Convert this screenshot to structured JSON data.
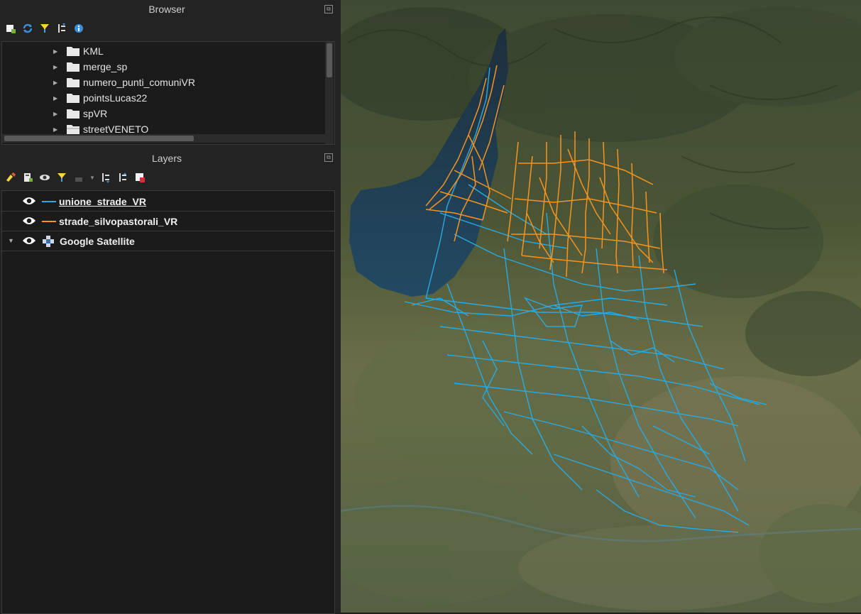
{
  "browser": {
    "title": "Browser",
    "items": [
      {
        "label": "KML"
      },
      {
        "label": "merge_sp"
      },
      {
        "label": "numero_punti_comuniVR"
      },
      {
        "label": "pointsLucas22"
      },
      {
        "label": "spVR"
      },
      {
        "label": "streetVENETO"
      }
    ]
  },
  "layers": {
    "title": "Layers",
    "items": [
      {
        "label": "unione_strade_VR",
        "color": "#29aae2"
      },
      {
        "label": "strade_silvopastorali_VR",
        "color": "#f7931e"
      },
      {
        "label": "Google Satellite"
      }
    ]
  },
  "colors": {
    "panel_bg": "#232323",
    "accent_blue": "#29aae2",
    "accent_orange": "#f7931e"
  }
}
